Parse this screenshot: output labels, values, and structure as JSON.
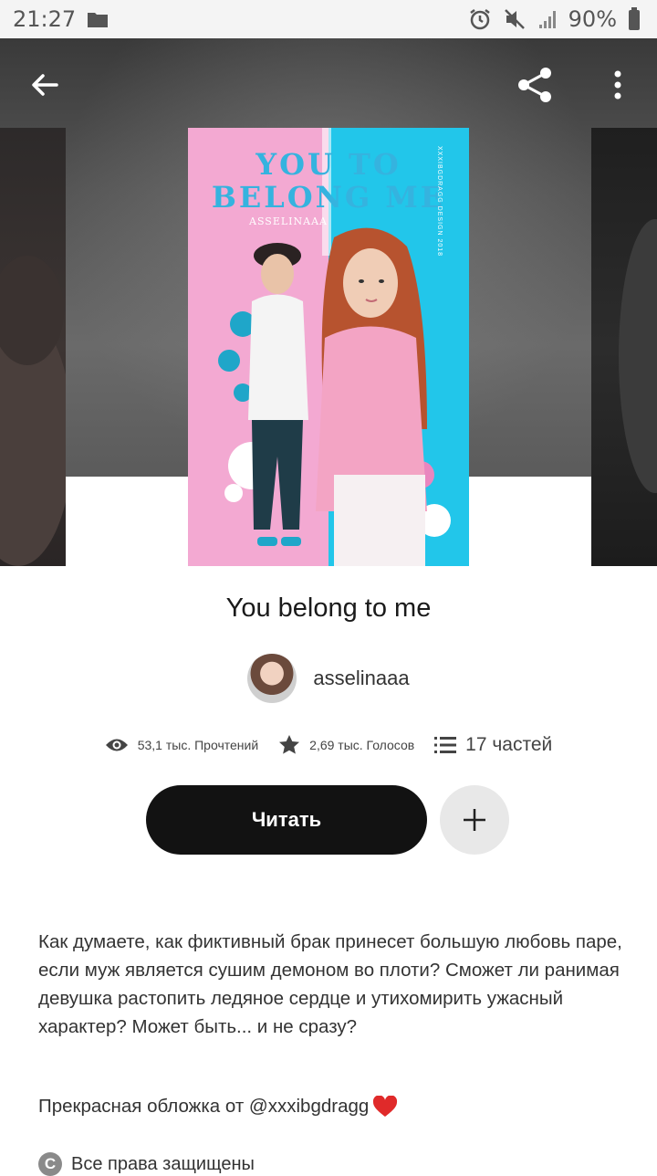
{
  "status_bar": {
    "time": "21:27",
    "battery": "90%",
    "icons": [
      "folder-icon",
      "alarm-icon",
      "mute-icon",
      "signal-icon",
      "battery-icon"
    ]
  },
  "toolbar": {
    "back_icon": "arrow-left-icon",
    "share_icon": "share-icon",
    "menu_icon": "more-vertical-icon"
  },
  "cover": {
    "title_line1": "YOU TO",
    "title_line2": "BELONG ME",
    "author_text": "ASSELINAAA",
    "side_text": "XXXIBGDRAGG DESIGN 2018",
    "colors": {
      "left": "#f3a9d2",
      "right": "#22c6ea",
      "title": "#35b3df"
    }
  },
  "story": {
    "title": "You belong to me",
    "author": "asselinaaa",
    "reads": "53,1 тыс. Прочтений",
    "votes": "2,69 тыс. Голосов",
    "parts": "17 частей",
    "read_button": "Читать",
    "description": "Как думаете, как фиктивный брак принесет большую любовь паре, если муж является сушим демоном во плоти? Сможет ли ранимая девушка растопить ледяное сердце и утихомирить ужасный характер? Может быть... и не сразу?",
    "credit": "Прекрасная обложка от @xxxibgdragg",
    "credit_icon": "heart-icon",
    "rights": "Все права защищены",
    "rights_symbol": "C"
  }
}
